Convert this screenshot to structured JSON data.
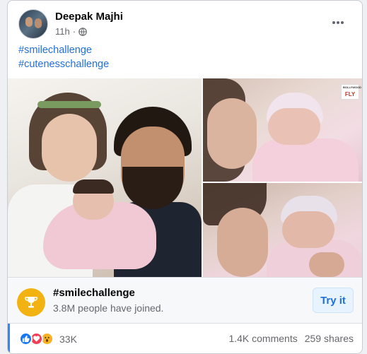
{
  "post": {
    "author": "Deepak Majhi",
    "time": "11h",
    "separator": "·",
    "privacy_icon": "globe-icon",
    "more_icon": "more-options-icon",
    "hashtags": [
      "#smilechallenge",
      "#cutenesschallenge"
    ]
  },
  "photo": {
    "watermark_top": "BOLLYWOOD",
    "watermark_bottom": "FLY"
  },
  "challenge": {
    "icon": "trophy-icon",
    "title": "#smilechallenge",
    "subtitle": "3.8M people have joined.",
    "button": "Try it"
  },
  "stats": {
    "reaction_icons": [
      "like-icon",
      "love-icon",
      "wow-icon"
    ],
    "reaction_count": "33K",
    "comments": "1.4K comments",
    "shares": "259 shares"
  },
  "colors": {
    "link": "#216fdb",
    "like": "#1877f2",
    "love": "#f33e58",
    "wow": "#f7b125",
    "trophy": "#f2b312"
  }
}
